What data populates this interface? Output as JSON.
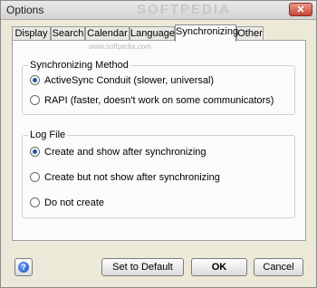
{
  "window": {
    "title": "Options",
    "watermark": "SOFTPEDIA",
    "close_glyph": "✕"
  },
  "tabs": [
    {
      "label": "Display",
      "active": false
    },
    {
      "label": "Search",
      "active": false
    },
    {
      "label": "Calendar",
      "active": false
    },
    {
      "label": "Language",
      "active": false
    },
    {
      "label": "Synchronizing",
      "active": true
    },
    {
      "label": "Other",
      "active": false
    }
  ],
  "panel": {
    "watermark_small": "www.softpedia.com",
    "sync_method": {
      "label": "Synchronizing Method",
      "options": [
        {
          "label": "ActiveSync Conduit (slower, universal)",
          "checked": true
        },
        {
          "label": "RAPI (faster, doesn't work on some communicators)",
          "checked": false
        }
      ]
    },
    "log_file": {
      "label": "Log File",
      "options": [
        {
          "label": "Create and show after synchronizing",
          "checked": true
        },
        {
          "label": "Create but not show after synchronizing",
          "checked": false
        },
        {
          "label": "Do not create",
          "checked": false
        }
      ]
    }
  },
  "buttons": {
    "help_glyph": "?",
    "set_default": "Set to Default",
    "ok": "OK",
    "cancel": "Cancel"
  }
}
